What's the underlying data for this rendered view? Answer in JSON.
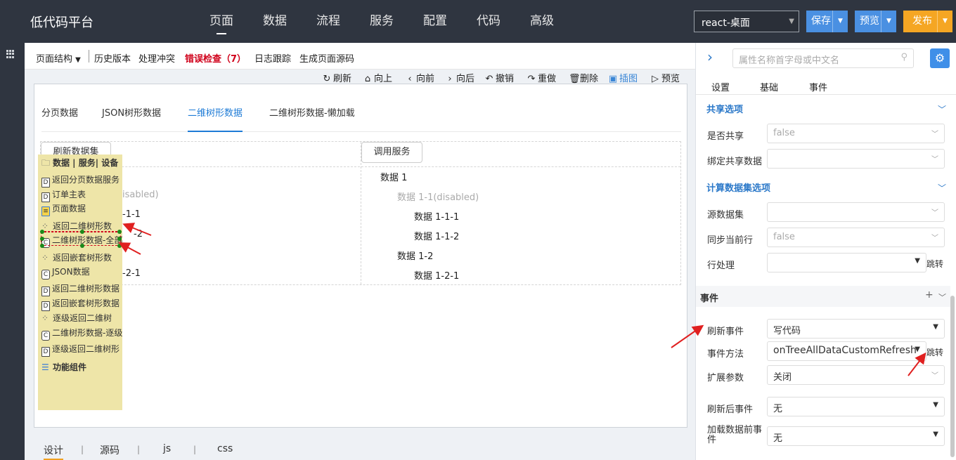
{
  "topbar": {
    "brand": "低代码平台",
    "nav": [
      "页面",
      "数据",
      "流程",
      "服务",
      "配置",
      "代码",
      "高级"
    ],
    "env_select": "react-桌面",
    "save": "保存",
    "preview": "预览",
    "publish": "发布",
    "save_color": "#4a90e2",
    "publish_color": "#f5a623"
  },
  "subtoolbar": {
    "page_structure": "页面结构",
    "history": "历史版本",
    "conflict": "处理冲突",
    "error_check": "错误检查（7）",
    "log": "日志跟踪",
    "gen_source": "生成页面源码"
  },
  "actions": [
    "刷新",
    "向上",
    "向前",
    "向后",
    "撤销",
    "重做",
    "删除",
    "插图",
    "预览"
  ],
  "tabs": [
    "分页数据",
    "JSON树形数据",
    "二维树形数据",
    "二维树形数据-懒加载"
  ],
  "grid": {
    "refresh_btn": "刷新数据集",
    "call_btn": "调用服务",
    "left_fragments": [
      "isabled)",
      "-1-1",
      "-2",
      "-2-1"
    ],
    "tree": [
      "数据 1",
      "数据 1-1(disabled)",
      "数据 1-1-1",
      "数据 1-1-2",
      "数据 1-2",
      "数据 1-2-1"
    ]
  },
  "popup": {
    "header": "数据 | 服务| 设备",
    "items": [
      {
        "icon": "D",
        "label": "返回分页数据服务"
      },
      {
        "icon": "D",
        "label": "订单主表"
      },
      {
        "icon": "db",
        "label": "页面数据"
      },
      {
        "icon": "grp",
        "label": "返回二维树形数"
      },
      {
        "icon": "C",
        "label": "二维树形数据-全部"
      },
      {
        "icon": "grp",
        "label": "返回嵌套树形数"
      },
      {
        "icon": "C",
        "label": "JSON数据"
      },
      {
        "icon": "D",
        "label": "返回二维树形数据"
      },
      {
        "icon": "D",
        "label": "返回嵌套树形数据"
      },
      {
        "icon": "grp",
        "label": "逐级返回二维树"
      },
      {
        "icon": "C",
        "label": "二维树形数据-逐级"
      },
      {
        "icon": "D",
        "label": "逐级返回二维树形"
      }
    ],
    "footer": "功能组件"
  },
  "bottom_tabs": [
    "设计",
    "源码",
    "js",
    "css"
  ],
  "right": {
    "search_placeholder": "属性名称首字母或中文名",
    "tabs": [
      "设置",
      "基础",
      "事件"
    ],
    "section_share": "共享选项",
    "is_shared_label": "是否共享",
    "is_shared_value": "false",
    "bind_shared_label": "绑定共享数据",
    "section_calc": "计算数据集选项",
    "source_label": "源数据集",
    "sync_label": "同步当前行",
    "sync_value": "false",
    "row_label": "行处理",
    "jump": "跳转",
    "events_title": "事件",
    "refresh_event_label": "刷新事件",
    "refresh_event_value": "写代码",
    "event_method_label": "事件方法",
    "event_method_value": "onTreeAllDataCustomRefresh",
    "ext_param_label": "扩展参数",
    "ext_param_value": "关闭",
    "after_refresh_label": "刷新后事件",
    "after_refresh_value": "无",
    "before_load_label": "加载数据前事件",
    "before_load_value": "无"
  }
}
